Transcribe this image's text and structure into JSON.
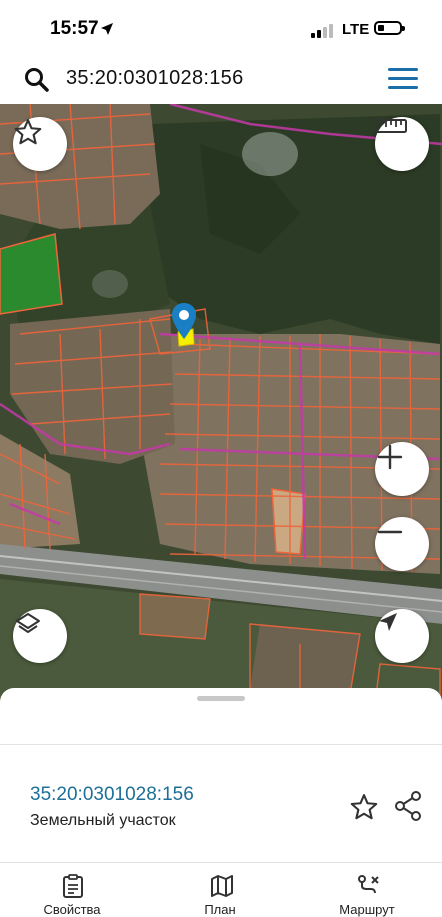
{
  "status_bar": {
    "time": "15:57",
    "network": "LTE"
  },
  "search": {
    "query": "35:20:0301028:156"
  },
  "map": {
    "buttons": [
      "favorite-star",
      "ruler",
      "zoom-in",
      "zoom-out",
      "layers",
      "my-location"
    ],
    "zoom_in_label": "+",
    "zoom_out_label": "−"
  },
  "parcel": {
    "cadastral_number": "35:20:0301028:156",
    "type": "Земельный участок"
  },
  "tabs": [
    {
      "label": "Свойства",
      "icon": "clipboard-icon"
    },
    {
      "label": "План",
      "icon": "map-icon"
    },
    {
      "label": "Маршрут",
      "icon": "route-icon"
    }
  ],
  "colors": {
    "accent": "#1b6ea8",
    "link": "#1d6f98",
    "parcel_border": "#f0643a",
    "marker": "#1a7fc4"
  }
}
